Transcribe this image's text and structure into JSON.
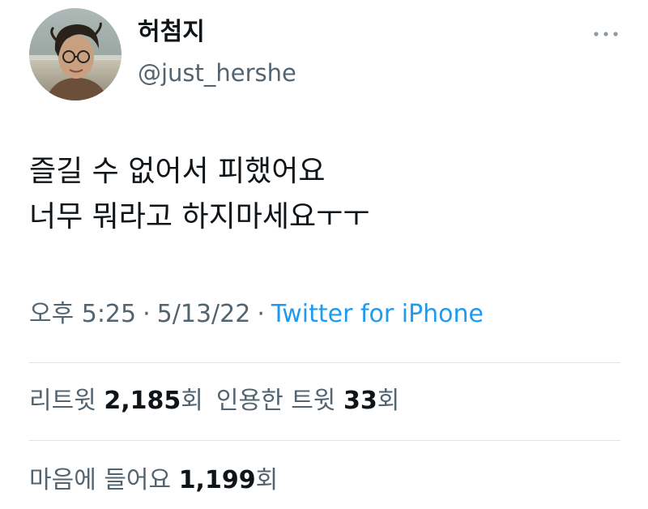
{
  "user": {
    "display_name": "허첨지",
    "handle": "@just_hershe"
  },
  "tweet": {
    "line1": "즐길 수 없어서 피했어요",
    "line2": "너무 뭐라고 하지마세요ㅜㅜ"
  },
  "meta": {
    "time": "오후 5:25",
    "separator": "·",
    "date": "5/13/22",
    "source": "Twitter for iPhone"
  },
  "stats": {
    "retweets_label": "리트윗",
    "retweets_count": "2,185",
    "retweets_unit": "회",
    "quotes_label": "인용한 트윗",
    "quotes_count": "33",
    "quotes_unit": "회",
    "likes_label": "마음에 들어요",
    "likes_count": "1,199",
    "likes_unit": "회"
  },
  "icons": {
    "more": "more-horizontal-icon"
  },
  "colors": {
    "text_primary": "#0f1419",
    "text_secondary": "#536471",
    "link": "#1d9bf0",
    "divider": "#dfe3e6"
  }
}
